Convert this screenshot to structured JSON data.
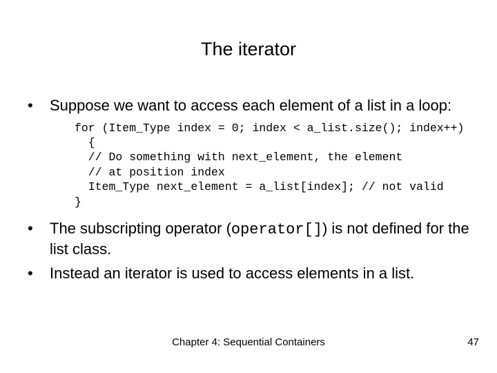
{
  "title": "The iterator",
  "bullets": {
    "b1": "Suppose we want to access each element of a list in a loop:",
    "b2_pre": "The subscripting operator (",
    "b2_code": "operator[]",
    "b2_post": ") is not defined for the list class.",
    "b3": "Instead an iterator is used to access elements in a list."
  },
  "code": {
    "l1": "for (Item_Type index = 0; index < a_list.size(); index++)",
    "l2": "  {",
    "l3": "  // Do something with next_element, the element",
    "l4": "  // at position index",
    "l5": "  Item_Type next_element = a_list[index]; // not valid",
    "l6": "}"
  },
  "footer": {
    "chapter": "Chapter 4: Sequential Containers",
    "page": "47"
  }
}
